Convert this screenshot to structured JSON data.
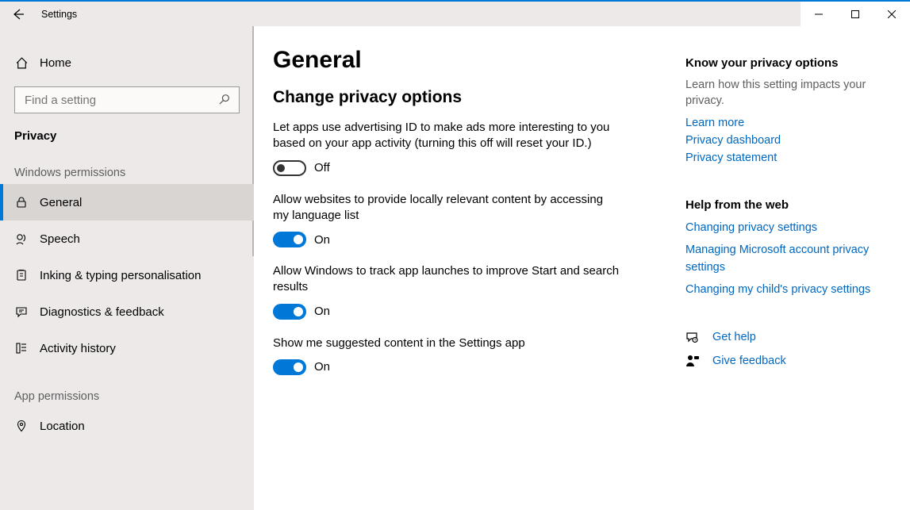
{
  "window": {
    "title": "Settings"
  },
  "sidebar": {
    "home_label": "Home",
    "search_placeholder": "Find a setting",
    "category_heading": "Privacy",
    "group_windows": "Windows permissions",
    "group_app": "App permissions",
    "items_windows": [
      {
        "label": "General",
        "iconName": "lock-icon",
        "selected": true
      },
      {
        "label": "Speech",
        "iconName": "speech-icon",
        "selected": false
      },
      {
        "label": "Inking & typing personalisation",
        "iconName": "clipboard-icon",
        "selected": false
      },
      {
        "label": "Diagnostics & feedback",
        "iconName": "feedback-icon",
        "selected": false
      },
      {
        "label": "Activity history",
        "iconName": "history-icon",
        "selected": false
      }
    ],
    "items_app": [
      {
        "label": "Location",
        "iconName": "location-icon",
        "selected": false
      }
    ]
  },
  "page": {
    "title": "General",
    "section_title": "Change privacy options",
    "settings": [
      {
        "desc": "Let apps use advertising ID to make ads more interesting to you based on your app activity (turning this off will reset your ID.)",
        "state": "off",
        "state_label": "Off"
      },
      {
        "desc": "Allow websites to provide locally relevant content by accessing my language list",
        "state": "on",
        "state_label": "On"
      },
      {
        "desc": "Allow Windows to track app launches to improve Start and search results",
        "state": "on",
        "state_label": "On"
      },
      {
        "desc": "Show me suggested content in the Settings app",
        "state": "on",
        "state_label": "On"
      }
    ]
  },
  "right": {
    "block1_heading": "Know your privacy options",
    "block1_sub": "Learn how this setting impacts your privacy.",
    "block1_links": [
      "Learn more",
      "Privacy dashboard",
      "Privacy statement"
    ],
    "block2_heading": "Help from the web",
    "block2_links": [
      "Changing privacy settings",
      "Managing Microsoft account privacy settings",
      "Changing my child's privacy settings"
    ],
    "help_label": "Get help",
    "feedback_label": "Give feedback"
  }
}
